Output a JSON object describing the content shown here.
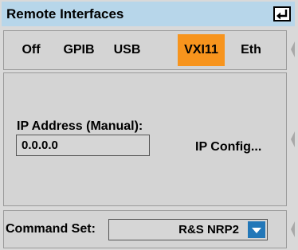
{
  "title": "Remote Interfaces",
  "tabs": [
    {
      "label": "Off",
      "active": false
    },
    {
      "label": "GPIB",
      "active": false
    },
    {
      "label": "USB",
      "active": false
    },
    {
      "label": "VXI11",
      "active": true
    },
    {
      "label": "Eth",
      "active": false
    }
  ],
  "ip": {
    "label": "IP Address (Manual):",
    "value": "0.0.0.0",
    "config_button": "IP Config..."
  },
  "command_set": {
    "label": "Command Set:",
    "value": "R&S NRP2"
  },
  "icons": {
    "enter": "enter-return-icon",
    "dropdown": "chevron-down-icon",
    "scroll": "side-scroll-handle-icon"
  },
  "colors": {
    "title_bar": "#b7d6ea",
    "active_tab": "#f7941d",
    "dropdown_button": "#2277b8",
    "background": "#d4d4d4"
  }
}
